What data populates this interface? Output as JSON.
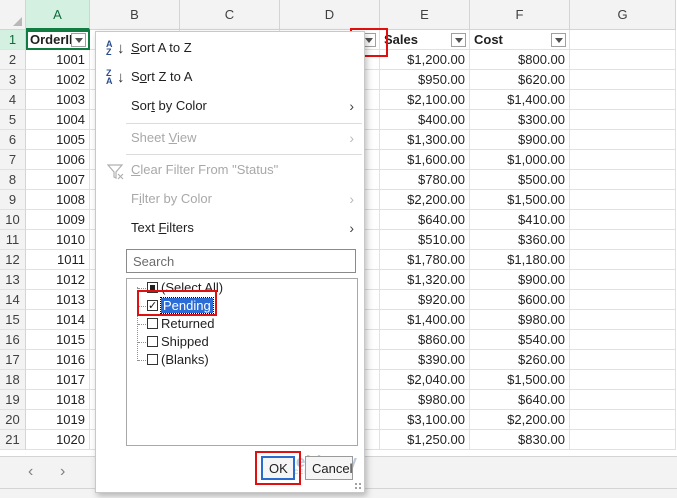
{
  "columns": [
    "A",
    "B",
    "C",
    "D",
    "E",
    "F",
    "G"
  ],
  "active_column": "A",
  "headers": {
    "order_id": "OrderID",
    "sales": "Sales",
    "cost": "Cost"
  },
  "rows": [
    {
      "n": "1"
    },
    {
      "n": "2",
      "id": "1001",
      "sales": "$1,200.00",
      "cost": "$800.00"
    },
    {
      "n": "3",
      "id": "1002",
      "sales": "$950.00",
      "cost": "$620.00"
    },
    {
      "n": "4",
      "id": "1003",
      "sales": "$2,100.00",
      "cost": "$1,400.00"
    },
    {
      "n": "5",
      "id": "1004",
      "sales": "$400.00",
      "cost": "$300.00"
    },
    {
      "n": "6",
      "id": "1005",
      "sales": "$1,300.00",
      "cost": "$900.00"
    },
    {
      "n": "7",
      "id": "1006",
      "sales": "$1,600.00",
      "cost": "$1,000.00"
    },
    {
      "n": "8",
      "id": "1007",
      "sales": "$780.00",
      "cost": "$500.00"
    },
    {
      "n": "9",
      "id": "1008",
      "sales": "$2,200.00",
      "cost": "$1,500.00"
    },
    {
      "n": "10",
      "id": "1009",
      "sales": "$640.00",
      "cost": "$410.00"
    },
    {
      "n": "11",
      "id": "1010",
      "sales": "$510.00",
      "cost": "$360.00"
    },
    {
      "n": "12",
      "id": "1011",
      "sales": "$1,780.00",
      "cost": "$1,180.00"
    },
    {
      "n": "13",
      "id": "1012",
      "sales": "$1,320.00",
      "cost": "$900.00"
    },
    {
      "n": "14",
      "id": "1013",
      "sales": "$920.00",
      "cost": "$600.00"
    },
    {
      "n": "15",
      "id": "1014",
      "sales": "$1,400.00",
      "cost": "$980.00"
    },
    {
      "n": "16",
      "id": "1015",
      "sales": "$860.00",
      "cost": "$540.00"
    },
    {
      "n": "17",
      "id": "1016",
      "sales": "$390.00",
      "cost": "$260.00"
    },
    {
      "n": "18",
      "id": "1017",
      "sales": "$2,040.00",
      "cost": "$1,500.00"
    },
    {
      "n": "19",
      "id": "1018",
      "sales": "$980.00",
      "cost": "$640.00"
    },
    {
      "n": "20",
      "id": "1019",
      "sales": "$3,100.00",
      "cost": "$2,200.00"
    },
    {
      "n": "21",
      "id": "1020",
      "sales": "$1,250.00",
      "cost": "$830.00"
    }
  ],
  "menu": {
    "sort_az": "Sort A to Z",
    "sort_za": "Sort Z to A",
    "sort_by_color": "Sort by Color",
    "sheet_view": "Sheet View",
    "clear_filter": "Clear Filter From \"Status\"",
    "filter_by_color": "Filter by Color",
    "text_filters": "Text Filters",
    "search_placeholder": "Search",
    "select_all": "(Select All)",
    "values": [
      "Pending",
      "Returned",
      "Shipped",
      "(Blanks)"
    ],
    "checked": [
      true,
      false,
      false,
      false
    ],
    "ok": "OK",
    "cancel": "Cancel"
  },
  "watermark": {
    "brand": "exceldemy",
    "tagline": "EXCEL · DATA · BI"
  },
  "icons": {
    "sort_az": "sort-ascending-icon",
    "sort_za": "sort-descending-icon",
    "clear_filter": "clear-filter-icon",
    "submenu": "chevron-right-icon",
    "filter_dropdown": "filter-dropdown-icon"
  },
  "colors": {
    "accent": "#107c41",
    "highlight": "#e01010",
    "selection": "#2b6cd6"
  }
}
